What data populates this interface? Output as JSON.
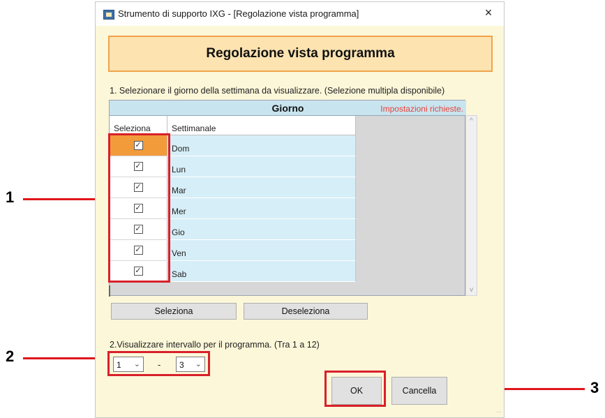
{
  "window": {
    "title": "Strumento di supporto IXG - [Regolazione vista programma]",
    "close_label": "×"
  },
  "header": {
    "title": "Regolazione vista programma"
  },
  "section1": {
    "instruction": "1. Selezionare il giorno della settimana da visualizzare. (Selezione multipla disponibile)"
  },
  "grid": {
    "group_header": "Giorno",
    "required_note": "Impostazioni richieste.",
    "columns": [
      "Seleziona",
      "Settimanale"
    ],
    "rows": [
      {
        "day": "Dom",
        "checked": true,
        "selected": true
      },
      {
        "day": "Lun",
        "checked": true,
        "selected": false
      },
      {
        "day": "Mar",
        "checked": true,
        "selected": false
      },
      {
        "day": "Mer",
        "checked": true,
        "selected": false
      },
      {
        "day": "Gio",
        "checked": true,
        "selected": false
      },
      {
        "day": "Ven",
        "checked": true,
        "selected": false
      },
      {
        "day": "Sab",
        "checked": true,
        "selected": false
      }
    ],
    "scroll_up": "^",
    "scroll_down": "v"
  },
  "buttons": {
    "select_all": "Seleziona",
    "deselect_all": "Deseleziona",
    "ok": "OK",
    "cancel": "Cancella"
  },
  "section2": {
    "instruction": "2.Visualizzare intervallo per il programma. (Tra 1 a 12)",
    "from_value": "1",
    "separator": "-",
    "to_value": "3"
  },
  "callouts": [
    "1",
    "2",
    "3"
  ],
  "colors": {
    "callout_red": "#d8202a",
    "header_orange": "#f0a24c",
    "selected_row": "#f29b3b",
    "required_text": "#e8443a"
  }
}
